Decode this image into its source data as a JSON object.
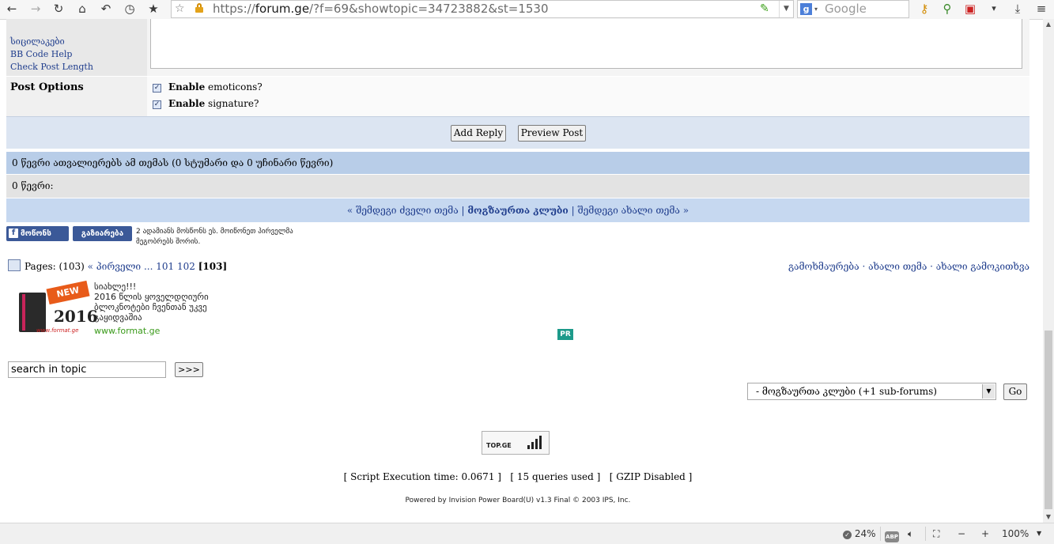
{
  "browser": {
    "url_prefix": "https://",
    "url_domain": "forum.ge",
    "url_rest": "/?f=69&showtopic=34723882&st=1530",
    "search_placeholder": "Google",
    "zoom": "100%",
    "percent": "24%",
    "icons": [
      "back-icon",
      "forward-icon",
      "reload-icon",
      "home-icon",
      "history-icon",
      "clock-icon",
      "star-icon"
    ]
  },
  "reply_form": {
    "left_links": [
      "სიცილაკები",
      "BB Code Help",
      "Check Post Length"
    ],
    "post_options_label": "Post Options",
    "options": [
      {
        "bold": "Enable",
        "text": " emoticons?"
      },
      {
        "bold": "Enable",
        "text": " signature?"
      }
    ],
    "add_reply": "Add Reply",
    "preview_post": "Preview Post"
  },
  "viewers": {
    "summary": "0 წევრი ათვალიერებს ამ თემას (0 სტუმარი და 0 უჩინარი წევრი)",
    "members": "0 წევრი:"
  },
  "topic_nav": {
    "prev": "« შემდეგი ძველი თემა",
    "sep": " | ",
    "forum": "მოგზაურთა კლუბი",
    "next": "შემდეგი ახალი თემა »"
  },
  "facebook": {
    "like": "მოწონს",
    "share": "გაზიარება",
    "text_line1": "2 ადამიანს მოსწონს ეს. მოიწონეთ პირველმა",
    "text_line2": "მეგობრებს შორის."
  },
  "pagination": {
    "label": "Pages:",
    "count": "(103)",
    "first": "« პირველი",
    "ellipsis": "...",
    "p1": "101",
    "p2": "102",
    "current": "103"
  },
  "topic_links": "გამოხმაურება · ახალი თემა · ახალი გამოკითხვა",
  "ad": {
    "line1": "სიახლე!!!",
    "line2": "2016 წლის ყოველდღიური",
    "line3": "ბლოკნოტები ჩვენთან უკვე",
    "line4": "გაყიდვაშია",
    "url": "www.format.ge",
    "badge": "NEW",
    "year": "2016",
    "img_url": "www.format.ge",
    "pr": "PR"
  },
  "search": {
    "value": "search in topic",
    "button": ">>>"
  },
  "forum_jump": {
    "selected": "- მოგზაურთა კლუბი (+1 sub-forums)",
    "button": "Go"
  },
  "topge_label": "TOP.GE",
  "footer": {
    "stats": "[ Script Execution time: 0.0671 ]   [ 15 queries used ]   [ GZIP Disabled ]",
    "powered": "Powered by Invision Power Board(U) v1.3 Final © 2003  IPS, Inc."
  }
}
